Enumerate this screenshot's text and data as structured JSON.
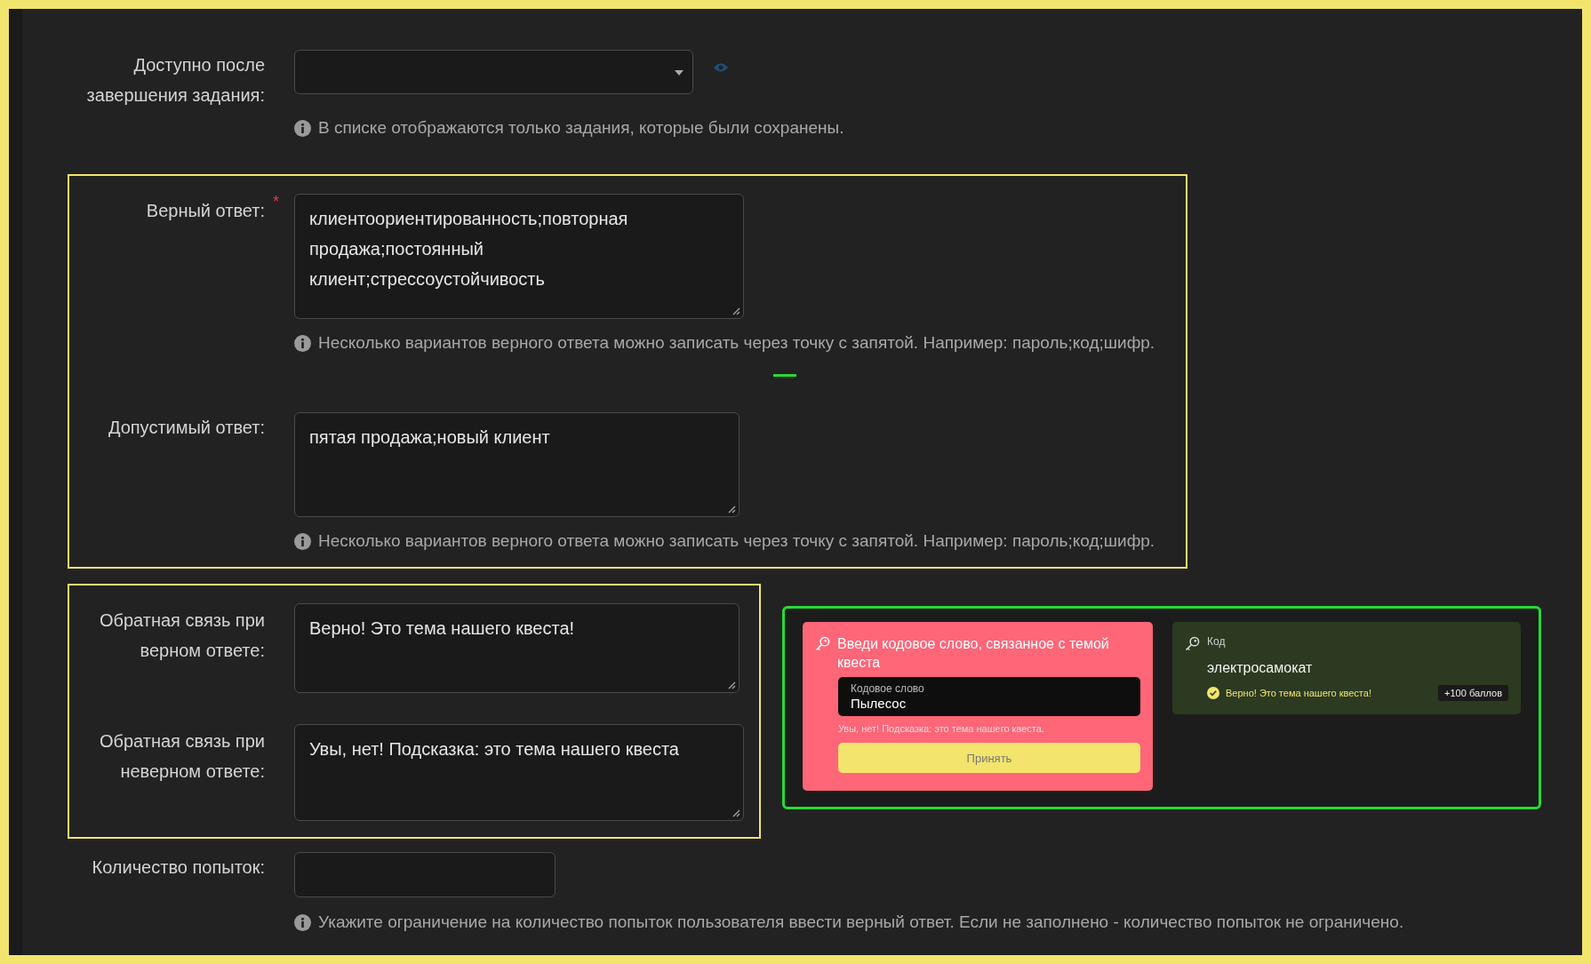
{
  "available_after": {
    "label": "Доступно после завершения задания:",
    "hint": "В списке отображаются только задания, которые были сохранены."
  },
  "answers_group": {
    "fields": [
      {
        "label": "Верный ответ:",
        "required_mark": "*",
        "value": "клиентоориентированность;повторная продажа;постоянный клиент;стрессоустойчивость",
        "hint": "Несколько вариантов верного ответа можно записать через точку с запятой. Например: пароль;код;шифр."
      },
      {
        "label": "Допустимый ответ:",
        "value": "пятая продажа;новый клиент",
        "hint": "Несколько вариантов верного ответа можно записать через точку с запятой. Например: пароль;код;шифр."
      }
    ]
  },
  "feedback_group": {
    "fields": [
      {
        "label": "Обратная связь при верном ответе:",
        "value": "Верно! Это тема нашего квеста!"
      },
      {
        "label": "Обратная связь при неверном ответе:",
        "value": "Увы, нет! Подсказка: это тема нашего квеста"
      }
    ]
  },
  "preview": {
    "wrong_card": {
      "title": "Введи кодовое слово, связанное с темой квеста",
      "input_label": "Кодовое слово",
      "input_value": "Пылесос",
      "error": "Увы, нет! Подсказка: это тема нашего квеста.",
      "button": "Принять"
    },
    "correct_card": {
      "label": "Код",
      "answer": "электросамокат",
      "feedback": "Верно! Это тема нашего квеста!",
      "points": "+100 баллов"
    }
  },
  "attempts": {
    "label": "Количество попыток:",
    "hint": "Укажите ограничение на количество попыток пользователя ввести верный ответ. Если не заполнено - количество попыток не ограничено."
  }
}
